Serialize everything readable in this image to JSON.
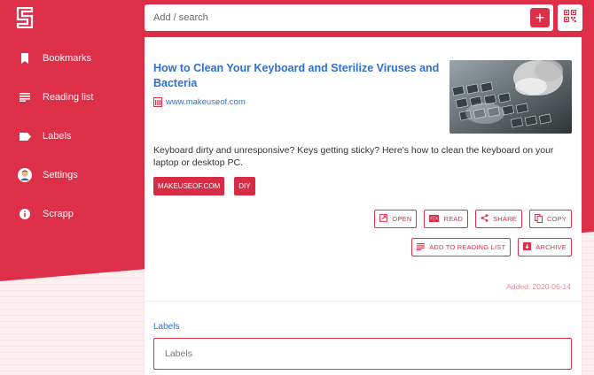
{
  "app": {
    "brand_color": "#de2f49",
    "link_color": "#2f6fd1"
  },
  "sidebar": {
    "logo_icon": "scrapp-logo",
    "items": [
      {
        "label": "Bookmarks",
        "icon": "bookmark-icon"
      },
      {
        "label": "Reading list",
        "icon": "list-icon"
      },
      {
        "label": "Labels",
        "icon": "label-icon"
      },
      {
        "label": "Settings",
        "icon": "avatar-icon"
      },
      {
        "label": "Scrapp",
        "icon": "info-icon"
      }
    ]
  },
  "topbar": {
    "search_placeholder": "Add / search",
    "add_label": "+",
    "qr_icon": "qr-code-icon"
  },
  "bookmark": {
    "title": "How to Clean Your Keyboard and Sterilize Viruses and Bacteria",
    "domain": "www.makeuseof.com",
    "description": "Keyboard dirty and unresponsive? Keys getting sticky? Here's how to clean the keyboard on your laptop or desktop PC.",
    "tags": [
      "MAKEUSEOF.COM",
      "DIY"
    ],
    "actions_row1": [
      {
        "label": "OPEN",
        "icon": "open-external-icon"
      },
      {
        "label": "READ",
        "icon": "read-icon"
      },
      {
        "label": "SHARE",
        "icon": "share-icon"
      },
      {
        "label": "COPY",
        "icon": "copy-icon"
      }
    ],
    "actions_row2": [
      {
        "label": "ADD TO READING LIST",
        "icon": "list-icon"
      },
      {
        "label": "ARCHIVE",
        "icon": "archive-icon"
      }
    ],
    "added": "Added: 2020-06-14"
  },
  "labels": {
    "title": "Labels",
    "placeholder": "Labels"
  }
}
